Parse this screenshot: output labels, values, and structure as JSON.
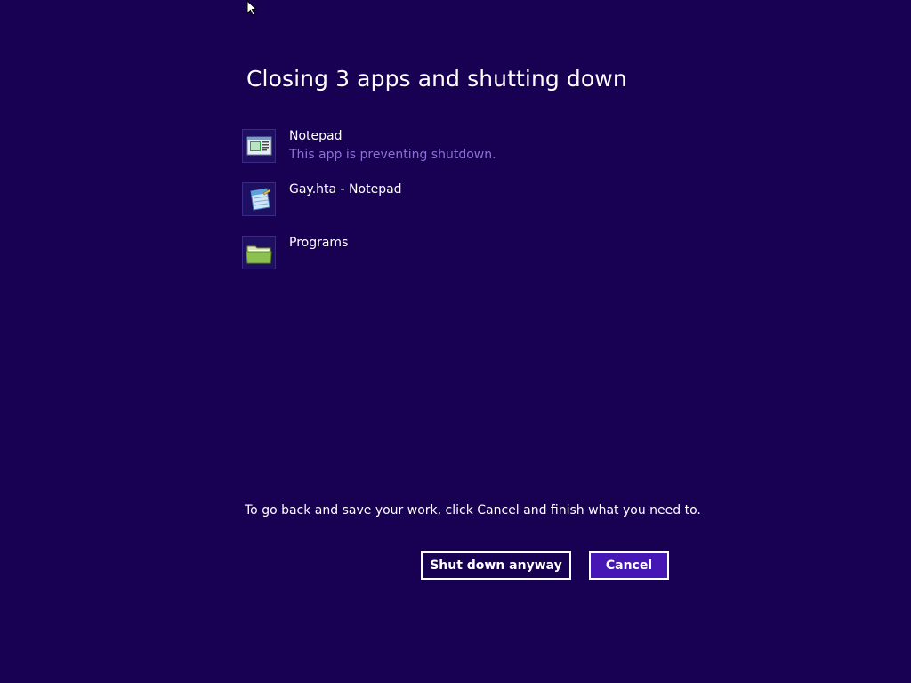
{
  "dialog": {
    "title": "Closing 3 apps and shutting down",
    "apps": [
      {
        "name": "Notepad",
        "status": "This app is preventing shutdown.",
        "icon": "notepad-window-icon"
      },
      {
        "name": "Gay.hta - Notepad",
        "status": "",
        "icon": "notepad-icon"
      },
      {
        "name": "Programs",
        "status": "",
        "icon": "folder-icon"
      }
    ],
    "footer_text": "To go back and save your work, click Cancel and finish what you need to.",
    "shutdown_button_label": "Shut down anyway",
    "cancel_button_label": "Cancel"
  },
  "colors": {
    "background": "#180052",
    "status_text": "#8a73d6",
    "cancel_button_bg": "#4617b4"
  }
}
